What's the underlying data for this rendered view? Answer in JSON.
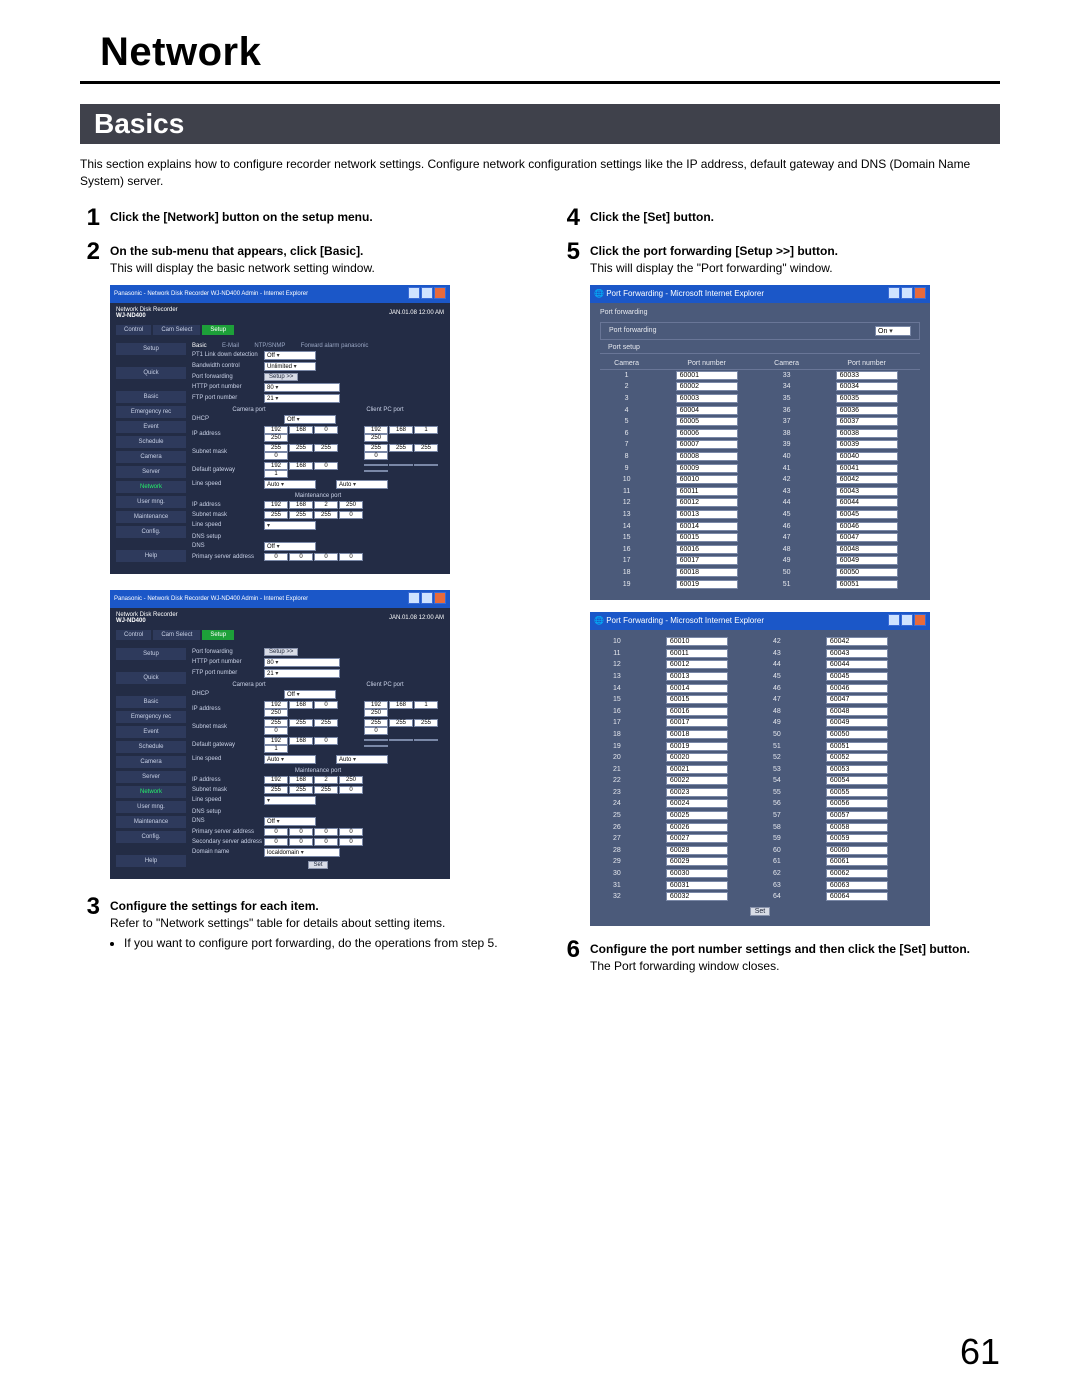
{
  "page": {
    "title": "Network",
    "section": "Basics",
    "number": "61"
  },
  "intro": "This section explains how to configure recorder network settings. Configure network configuration settings like the IP address, default gateway and DNS (Domain Name System) server.",
  "steps": {
    "s1": "Click the [Network] button on the setup menu.",
    "s2": "On the sub-menu that appears, click [Basic].",
    "s2_desc": "This will display the basic network setting window.",
    "s3": "Configure the settings for each item.",
    "s3_desc": "Refer to \"Network settings\" table for details about setting items.",
    "s3_bullet": "If you want to configure port forwarding, do the operations from step 5.",
    "s4": "Click the [Set] button.",
    "s5": "Click the port forwarding [Setup >>] button.",
    "s5_desc": "This will display the \"Port forwarding\" window.",
    "s6": "Configure the port number settings and then click the [Set] button.",
    "s6_desc": "The Port forwarding window closes."
  },
  "recorder": {
    "title": "Panasonic - Network Disk Recorder WJ-ND400    Admin - Internet Explorer",
    "model": "WJ-ND400",
    "brand": "Network Disk Recorder",
    "datetime": "JAN.01.08  12:00  AM",
    "tabs": [
      "Control",
      "Cam Select",
      "Setup"
    ],
    "side": [
      "Setup",
      "",
      "Quick",
      "",
      "Basic",
      "Emergency rec",
      "Event",
      "Schedule",
      "Camera",
      "Server",
      "Network",
      "User mng.",
      "Maintenance",
      "Config.",
      "",
      "Help"
    ],
    "side_hl_index": 10,
    "content_tabs": [
      "Basic",
      "E-Mail",
      "NTP/SNMP",
      "Forward alarm panasonic"
    ],
    "win1": {
      "rows_top": [
        {
          "lab": "PT1 Link down detection",
          "type": "sel",
          "val": "Off"
        },
        {
          "lab": "Bandwidth control",
          "type": "sel",
          "val": "Unlimited"
        },
        {
          "lab": "Port forwarding",
          "type": "btn",
          "val": "Setup >>"
        },
        {
          "lab": "HTTP port number",
          "type": "text",
          "val": "80"
        },
        {
          "lab": "FTP port number",
          "type": "text",
          "val": "21"
        }
      ],
      "col_hdr": [
        "Camera port",
        "Client PC port"
      ],
      "dhcp_label": "DHCP",
      "ip_rows": [
        {
          "lab": "IP address",
          "a": [
            "192",
            "168",
            "0",
            "250"
          ],
          "b": [
            "192",
            "168",
            "1",
            "250"
          ]
        },
        {
          "lab": "Subnet mask",
          "a": [
            "255",
            "255",
            "255",
            "0"
          ],
          "b": [
            "255",
            "255",
            "255",
            "0"
          ]
        },
        {
          "lab": "Default gateway",
          "a": [
            "192",
            "168",
            "0",
            "1"
          ],
          "b": [
            "",
            "",
            "",
            ""
          ]
        },
        {
          "lab": "Line speed",
          "a_sel": "Auto",
          "b_sel": "Auto"
        }
      ],
      "maint_hdr": "Maintenance port",
      "maint_rows": [
        {
          "lab": "IP address",
          "a": [
            "192",
            "168",
            "2",
            "250"
          ]
        },
        {
          "lab": "Subnet mask",
          "a": [
            "255",
            "255",
            "255",
            "0"
          ]
        },
        {
          "lab": "Line speed",
          "a_sel": ""
        }
      ],
      "dns_hdr": "DNS setup",
      "dns_rows": [
        {
          "lab": "DNS",
          "type": "sel",
          "val": "Off"
        },
        {
          "lab": "Primary server address",
          "a": [
            "0",
            "0",
            "0",
            "0"
          ]
        }
      ]
    },
    "win2": {
      "rows_top": [
        {
          "lab": "Port forwarding",
          "type": "btn",
          "val": "Setup >>"
        },
        {
          "lab": "HTTP port number",
          "type": "text",
          "val": "80"
        },
        {
          "lab": "FTP port number",
          "type": "text",
          "val": "21"
        }
      ],
      "col_hdr": [
        "Camera port",
        "Client PC port"
      ],
      "dhcp_label": "DHCP",
      "ip_rows": [
        {
          "lab": "IP address",
          "a": [
            "192",
            "168",
            "0",
            "250"
          ],
          "b": [
            "192",
            "168",
            "1",
            "250"
          ]
        },
        {
          "lab": "Subnet mask",
          "a": [
            "255",
            "255",
            "255",
            "0"
          ],
          "b": [
            "255",
            "255",
            "255",
            "0"
          ]
        },
        {
          "lab": "Default gateway",
          "a": [
            "192",
            "168",
            "0",
            "1"
          ],
          "b": [
            "",
            "",
            "",
            ""
          ]
        },
        {
          "lab": "Line speed",
          "a_sel": "Auto",
          "b_sel": "Auto"
        }
      ],
      "maint_hdr": "Maintenance port",
      "maint_rows": [
        {
          "lab": "IP address",
          "a": [
            "192",
            "168",
            "2",
            "250"
          ]
        },
        {
          "lab": "Subnet mask",
          "a": [
            "255",
            "255",
            "255",
            "0"
          ]
        },
        {
          "lab": "Line speed",
          "a_sel": ""
        }
      ],
      "dns_hdr": "DNS setup",
      "dns_rows": [
        {
          "lab": "DNS",
          "type": "sel",
          "val": "Off"
        },
        {
          "lab": "Primary server address",
          "a": [
            "0",
            "0",
            "0",
            "0"
          ]
        },
        {
          "lab": "Secondary server address",
          "a": [
            "0",
            "0",
            "0",
            "0"
          ]
        },
        {
          "lab": "Domain name",
          "type": "text",
          "val": "localdomain"
        }
      ],
      "set_label": "Set"
    }
  },
  "pf": {
    "title": "Port Forwarding - Microsoft Internet Explorer",
    "caption": "Port forwarding",
    "on_label": "Port forwarding",
    "on_value": "On",
    "sub": "Port setup",
    "headers": [
      "Camera",
      "Port number",
      "Camera",
      "Port number"
    ],
    "set_label": "Set",
    "win1_rows": [
      {
        "c1": 1,
        "p1": "60001",
        "c2": 33,
        "p2": "60033"
      },
      {
        "c1": 2,
        "p1": "60002",
        "c2": 34,
        "p2": "60034"
      },
      {
        "c1": 3,
        "p1": "60003",
        "c2": 35,
        "p2": "60035"
      },
      {
        "c1": 4,
        "p1": "60004",
        "c2": 36,
        "p2": "60036"
      },
      {
        "c1": 5,
        "p1": "60005",
        "c2": 37,
        "p2": "60037"
      },
      {
        "c1": 6,
        "p1": "60006",
        "c2": 38,
        "p2": "60038"
      },
      {
        "c1": 7,
        "p1": "60007",
        "c2": 39,
        "p2": "60039"
      },
      {
        "c1": 8,
        "p1": "60008",
        "c2": 40,
        "p2": "60040"
      },
      {
        "c1": 9,
        "p1": "60009",
        "c2": 41,
        "p2": "60041"
      },
      {
        "c1": 10,
        "p1": "60010",
        "c2": 42,
        "p2": "60042"
      },
      {
        "c1": 11,
        "p1": "60011",
        "c2": 43,
        "p2": "60043"
      },
      {
        "c1": 12,
        "p1": "60012",
        "c2": 44,
        "p2": "60044"
      },
      {
        "c1": 13,
        "p1": "60013",
        "c2": 45,
        "p2": "60045"
      },
      {
        "c1": 14,
        "p1": "60014",
        "c2": 46,
        "p2": "60046"
      },
      {
        "c1": 15,
        "p1": "60015",
        "c2": 47,
        "p2": "60047"
      },
      {
        "c1": 16,
        "p1": "60016",
        "c2": 48,
        "p2": "60048"
      },
      {
        "c1": 17,
        "p1": "60017",
        "c2": 49,
        "p2": "60049"
      },
      {
        "c1": 18,
        "p1": "60018",
        "c2": 50,
        "p2": "60050"
      },
      {
        "c1": 19,
        "p1": "60019",
        "c2": 51,
        "p2": "60051"
      }
    ],
    "win2_rows": [
      {
        "c1": 10,
        "p1": "60010",
        "c2": 42,
        "p2": "60042"
      },
      {
        "c1": 11,
        "p1": "60011",
        "c2": 43,
        "p2": "60043"
      },
      {
        "c1": 12,
        "p1": "60012",
        "c2": 44,
        "p2": "60044"
      },
      {
        "c1": 13,
        "p1": "60013",
        "c2": 45,
        "p2": "60045"
      },
      {
        "c1": 14,
        "p1": "60014",
        "c2": 46,
        "p2": "60046"
      },
      {
        "c1": 15,
        "p1": "60015",
        "c2": 47,
        "p2": "60047"
      },
      {
        "c1": 16,
        "p1": "60016",
        "c2": 48,
        "p2": "60048"
      },
      {
        "c1": 17,
        "p1": "60017",
        "c2": 49,
        "p2": "60049"
      },
      {
        "c1": 18,
        "p1": "60018",
        "c2": 50,
        "p2": "60050"
      },
      {
        "c1": 19,
        "p1": "60019",
        "c2": 51,
        "p2": "60051"
      },
      {
        "c1": 20,
        "p1": "60020",
        "c2": 52,
        "p2": "60052"
      },
      {
        "c1": 21,
        "p1": "60021",
        "c2": 53,
        "p2": "60053"
      },
      {
        "c1": 22,
        "p1": "60022",
        "c2": 54,
        "p2": "60054"
      },
      {
        "c1": 23,
        "p1": "60023",
        "c2": 55,
        "p2": "60055"
      },
      {
        "c1": 24,
        "p1": "60024",
        "c2": 56,
        "p2": "60056"
      },
      {
        "c1": 25,
        "p1": "60025",
        "c2": 57,
        "p2": "60057"
      },
      {
        "c1": 26,
        "p1": "60026",
        "c2": 58,
        "p2": "60058"
      },
      {
        "c1": 27,
        "p1": "60027",
        "c2": 59,
        "p2": "60059"
      },
      {
        "c1": 28,
        "p1": "60028",
        "c2": 60,
        "p2": "60060"
      },
      {
        "c1": 29,
        "p1": "60029",
        "c2": 61,
        "p2": "60061"
      },
      {
        "c1": 30,
        "p1": "60030",
        "c2": 62,
        "p2": "60062"
      },
      {
        "c1": 31,
        "p1": "60031",
        "c2": 63,
        "p2": "60063"
      },
      {
        "c1": 32,
        "p1": "60032",
        "c2": 64,
        "p2": "60064"
      }
    ]
  }
}
